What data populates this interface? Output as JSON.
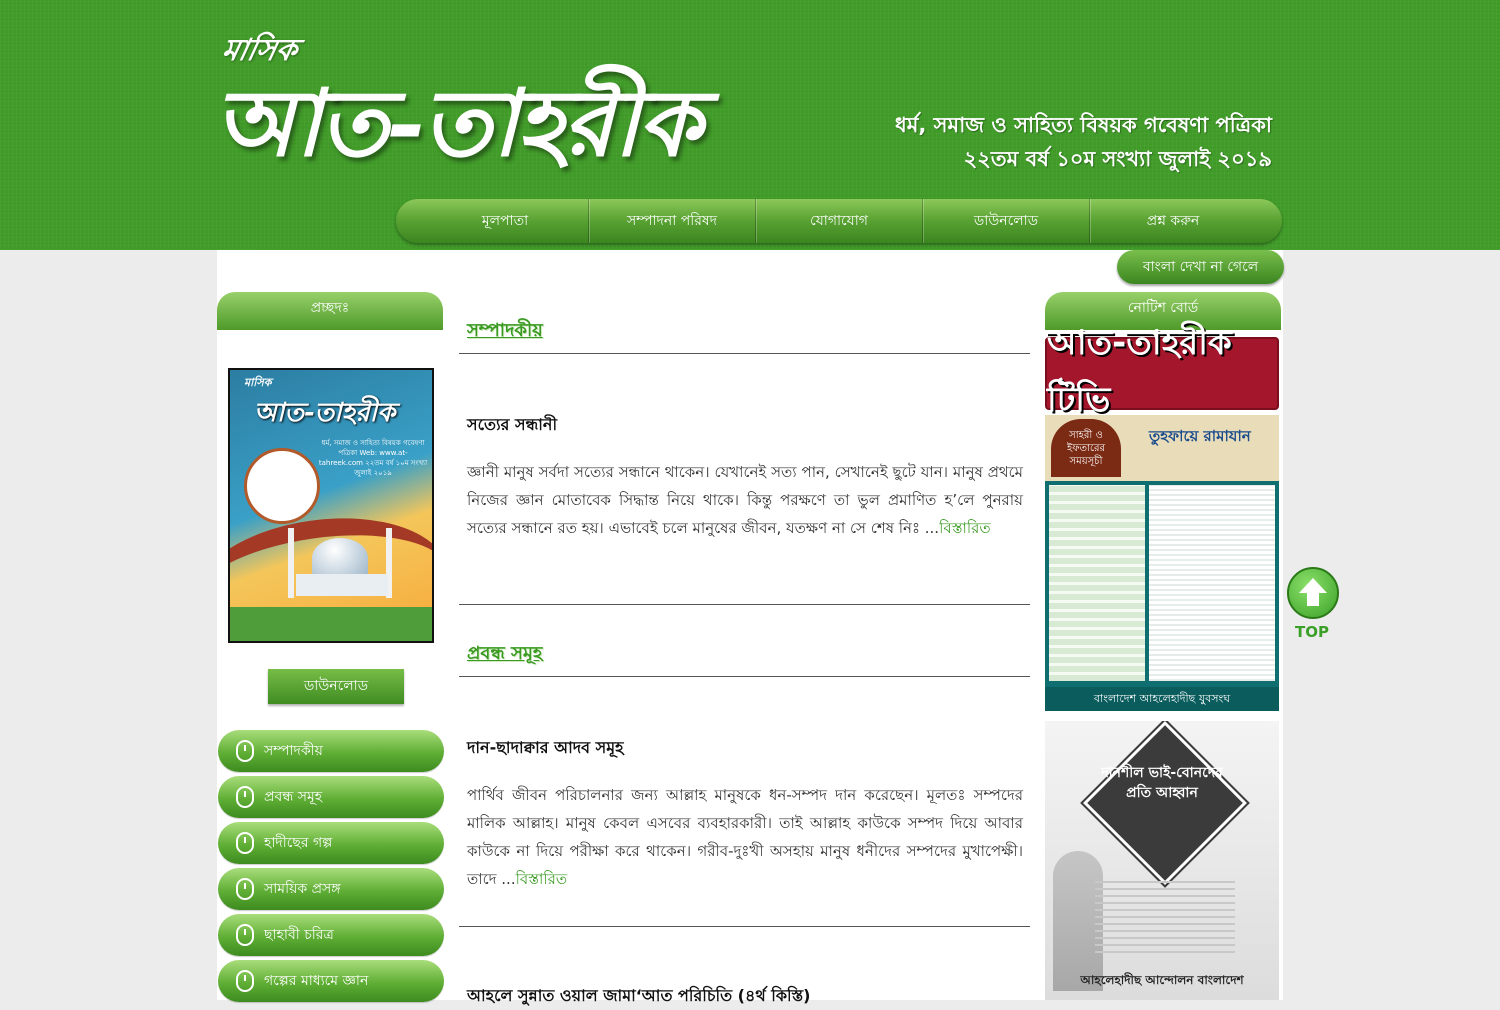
{
  "header": {
    "logo_small": "মাসিক",
    "logo_main": "আত-তাহরীক",
    "tagline_line1": "ধর্ম, সমাজ ও সাহিত্য বিষয়ক গবেষণা পত্রিকা",
    "tagline_line2": "২২তম বর্ষ ১০ম সংখ্যা জুলাই ২০১৯"
  },
  "nav": {
    "items": [
      "মূলপাতা",
      "সম্পাদনা পরিষদ",
      "যোগাযোগ",
      "ডাউনলোড",
      "প্রশ্ন করুন"
    ]
  },
  "bangla_button": "বাংলা দেখা না গেলে",
  "left": {
    "tab_label": "প্রচ্ছদঃ",
    "cover": {
      "small": "মাসিক",
      "title": "আত-তাহরীক",
      "info": "ধর্ম, সমাজ ও সাহিত্য বিষয়ক গবেষণা পত্রিকা Web: www.at-tahreek.com ২২তম বর্ষ ১০ম সংখ্যা জুলাই ২০১৯"
    },
    "download_label": "ডাউনলোড",
    "menu": [
      "সম্পাদকীয়",
      "প্রবন্ধ সমূহ",
      "হাদীছের গল্প",
      "সাময়িক প্রসঙ্গ",
      "ছাহাবী চরিত্র",
      "গল্পের মাধ্যমে জ্ঞান"
    ]
  },
  "main": {
    "section1": "সম্পাদকীয়",
    "article1": {
      "title": "সত্যের সন্ধানী",
      "body": "জ্ঞানী মানুষ সর্বদা সত্যের সন্ধানে থাকেন। যেখানেই সত্য পান, সেখানেই ছুটে যান। মানুষ প্রথমে নিজের জ্ঞান মোতাবেক সিদ্ধান্ত নিয়ে থাকে। কিন্তু পরক্ষণে তা ভুল প্রমাণিত হ’লে পুনরায় সত্যের সন্ধানে রত হয়। এভাবেই চলে মানুষের জীবন, যতক্ষণ না সে শেষ নিঃ ...",
      "more": "বিস্তারিত"
    },
    "section2": "প্রবন্ধ সমূহ",
    "article2": {
      "title": "দান-ছাদাক্বার আদব সমূহ",
      "body": "পার্থিব জীবন পরিচালনার জন্য আল্লাহ মানুষকে ধন-সম্পদ দান করেছেন। মূলতঃ সম্পদের মালিক আল্লাহ। মানুষ কেবল এসবের ব্যবহারকারী। তাই আল্লাহ কাউকে সম্পদ দিয়ে আবার কাউকে না দিয়ে পরীক্ষা করে থাকেন। গরীব-দুঃখী অসহায় মানুষ ধনীদের সম্পদের মুখাপেক্ষী। তাদে ...",
      "more": "বিস্তারিত"
    },
    "article3": {
      "title": "আহলে সুন্নাত ওয়াল জামা‘আত পরিচিতি (৪র্থ কিস্তি)"
    }
  },
  "right": {
    "tab_label": "নোটিশ বোর্ড",
    "tv_banner": "আত-তাহরীক টিভি",
    "ramadan": {
      "small": "সাহরী ও ইফতারের সময়সূচী",
      "title": "তুহফায়ে রামাযান",
      "footer": "বাংলাদেশ আহলেহাদীছ যুবসংঘ"
    },
    "appeal": {
      "text": "দানশীল ভাই-বোনদের প্রতি আহ্বান",
      "footer": "আহলেহাদীছ আন্দোলন বাংলাদেশ"
    }
  },
  "top_button": "TOP"
}
